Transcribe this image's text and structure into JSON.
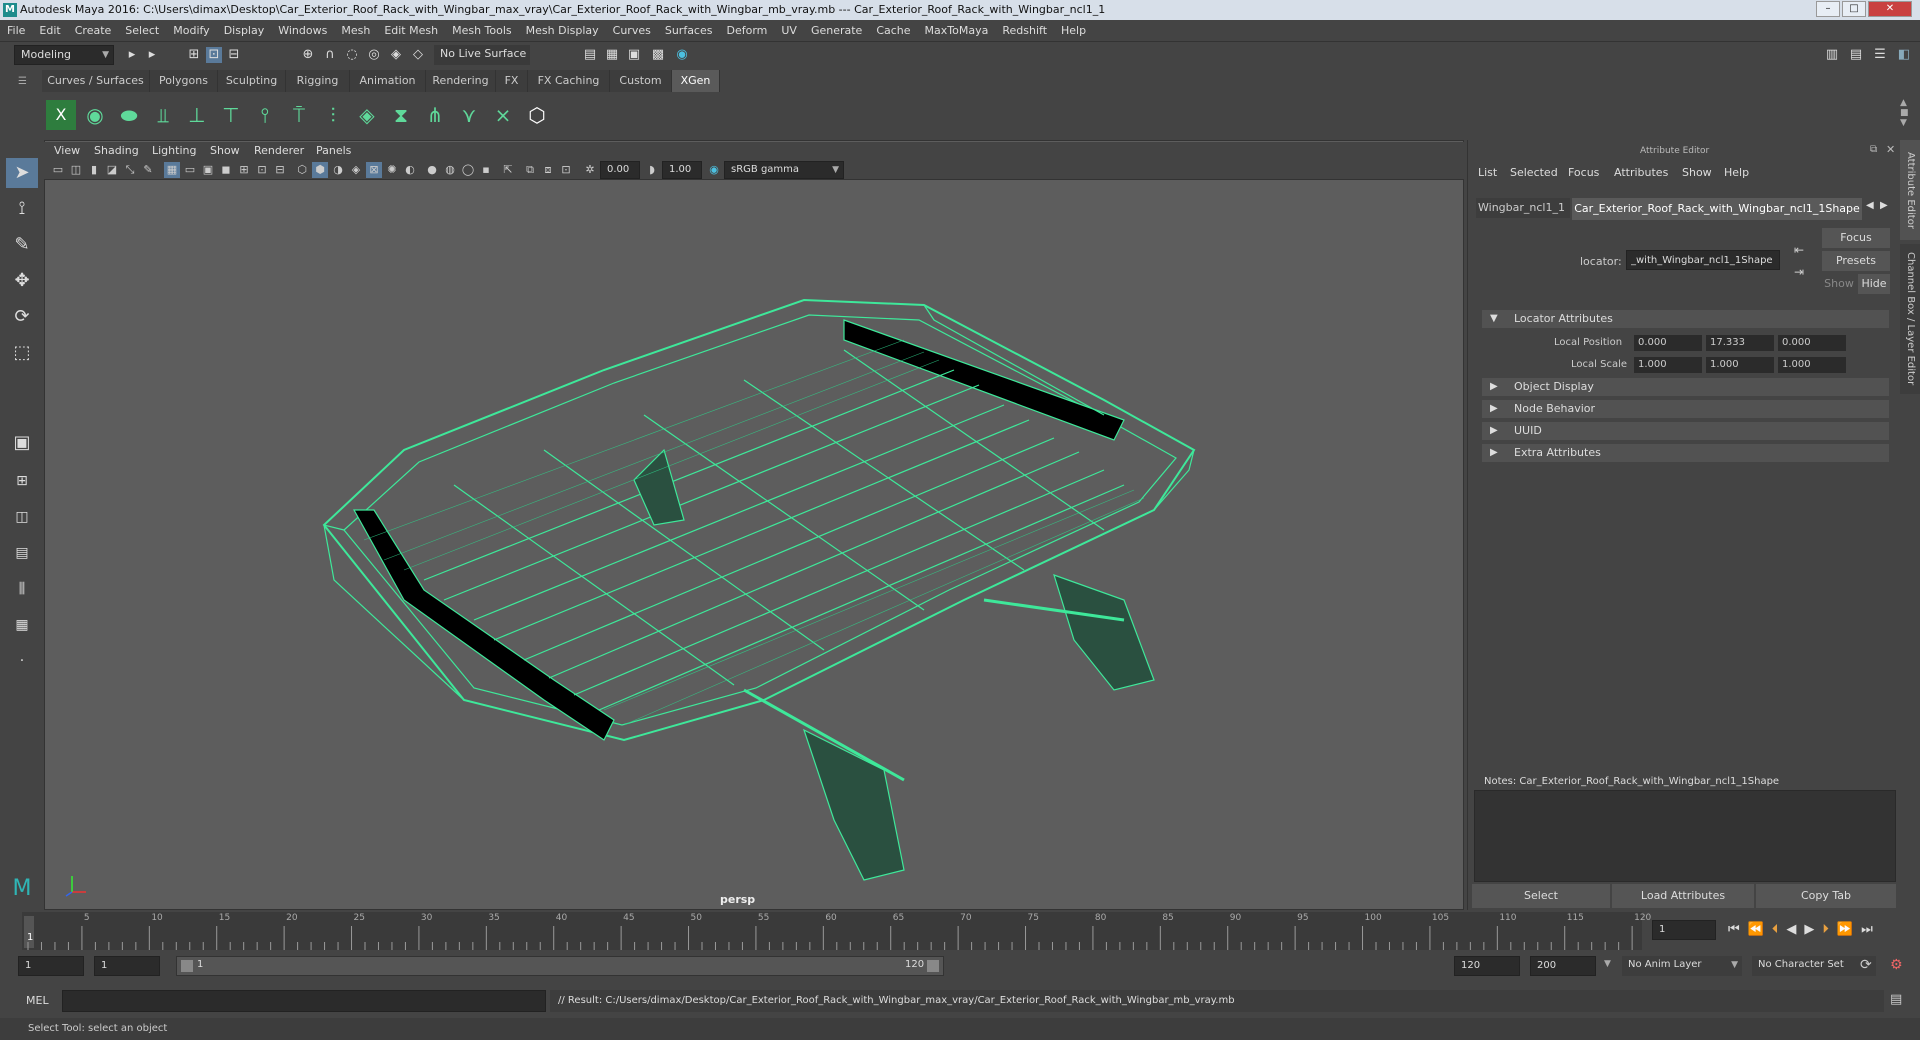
{
  "window": {
    "title": "Autodesk Maya 2016: C:\\Users\\dimax\\Desktop\\Car_Exterior_Roof_Rack_with_Wingbar_max_vray\\Car_Exterior_Roof_Rack_with_Wingbar_mb_vray.mb  ---  Car_Exterior_Roof_Rack_with_Wingbar_ncl1_1"
  },
  "menubar": [
    "File",
    "Edit",
    "Create",
    "Select",
    "Modify",
    "Display",
    "Windows",
    "Mesh",
    "Edit Mesh",
    "Mesh Tools",
    "Mesh Display",
    "Curves",
    "Surfaces",
    "Deform",
    "UV",
    "Generate",
    "Cache",
    "MaxToMaya",
    "Redshift",
    "Help"
  ],
  "status": {
    "mode": "Modeling",
    "live_surface": "No Live Surface"
  },
  "shelf_tabs": [
    "Curves / Surfaces",
    "Polygons",
    "Sculpting",
    "Rigging",
    "Animation",
    "Rendering",
    "FX",
    "FX Caching",
    "Custom",
    "XGen"
  ],
  "shelf_active": "XGen",
  "viewport": {
    "menus": [
      "View",
      "Shading",
      "Lighting",
      "Show",
      "Renderer",
      "Panels"
    ],
    "exposure": "0.00",
    "gamma": "1.00",
    "color_space": "sRGB gamma",
    "camera": "persp",
    "wire_color": "#3ee89a"
  },
  "attribute_editor": {
    "title": "Attribute Editor",
    "menus": [
      "List",
      "Selected",
      "Focus",
      "Attributes",
      "Show",
      "Help"
    ],
    "tabs": [
      "Wingbar_ncl1_1",
      "Car_Exterior_Roof_Rack_with_Wingbar_ncl1_1Shape"
    ],
    "locator_label": "locator:",
    "locator_value": "_with_Wingbar_ncl1_1Shape",
    "focus": "Focus",
    "presets": "Presets",
    "show": "Show",
    "hide": "Hide",
    "sections": [
      {
        "label": "Locator Attributes",
        "open": true
      },
      {
        "label": "Object Display",
        "open": false
      },
      {
        "label": "Node Behavior",
        "open": false
      },
      {
        "label": "UUID",
        "open": false
      },
      {
        "label": "Extra Attributes",
        "open": false
      }
    ],
    "local_position_label": "Local Position",
    "local_position": [
      "0.000",
      "17.333",
      "0.000"
    ],
    "local_scale_label": "Local Scale",
    "local_scale": [
      "1.000",
      "1.000",
      "1.000"
    ],
    "notes": "Notes:  Car_Exterior_Roof_Rack_with_Wingbar_ncl1_1Shape",
    "buttons": [
      "Select",
      "Load Attributes",
      "Copy Tab"
    ]
  },
  "side_tabs": [
    "Attribute Editor",
    "Channel Box / Layer Editor"
  ],
  "timeline": {
    "ticks": [
      "5",
      "10",
      "15",
      "20",
      "25",
      "30",
      "35",
      "40",
      "45",
      "50",
      "55",
      "60",
      "65",
      "70",
      "75",
      "80",
      "85",
      "90",
      "95",
      "100",
      "105",
      "110",
      "115",
      "120"
    ],
    "current_frame_marker": "1",
    "current_frame": "1"
  },
  "range": {
    "start": "1",
    "start2": "1",
    "slider_start": "1",
    "slider_end": "120",
    "end": "120",
    "end2": "200",
    "anim_layer": "No Anim Layer",
    "char_set": "No Character Set"
  },
  "cmd": {
    "label": "MEL",
    "result": "// Result: C:/Users/dimax/Desktop/Car_Exterior_Roof_Rack_with_Wingbar_max_vray/Car_Exterior_Roof_Rack_with_Wingbar_mb_vray.mb"
  },
  "help": "Select Tool: select an object"
}
